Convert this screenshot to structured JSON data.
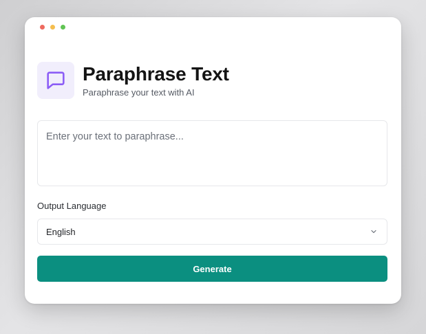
{
  "window": {
    "traffic_lights": [
      "close",
      "minimize",
      "maximize"
    ]
  },
  "header": {
    "icon": "chat-bubble-icon",
    "title": "Paraphrase Text",
    "subtitle": "Paraphrase your text with AI"
  },
  "input": {
    "value": "",
    "placeholder": "Enter your text to paraphrase..."
  },
  "language": {
    "label": "Output Language",
    "selected": "English"
  },
  "actions": {
    "generate_label": "Generate"
  },
  "colors": {
    "accent": "#0b8f80",
    "icon_bg": "#f1eefc",
    "icon_stroke": "#8b5cf6"
  }
}
